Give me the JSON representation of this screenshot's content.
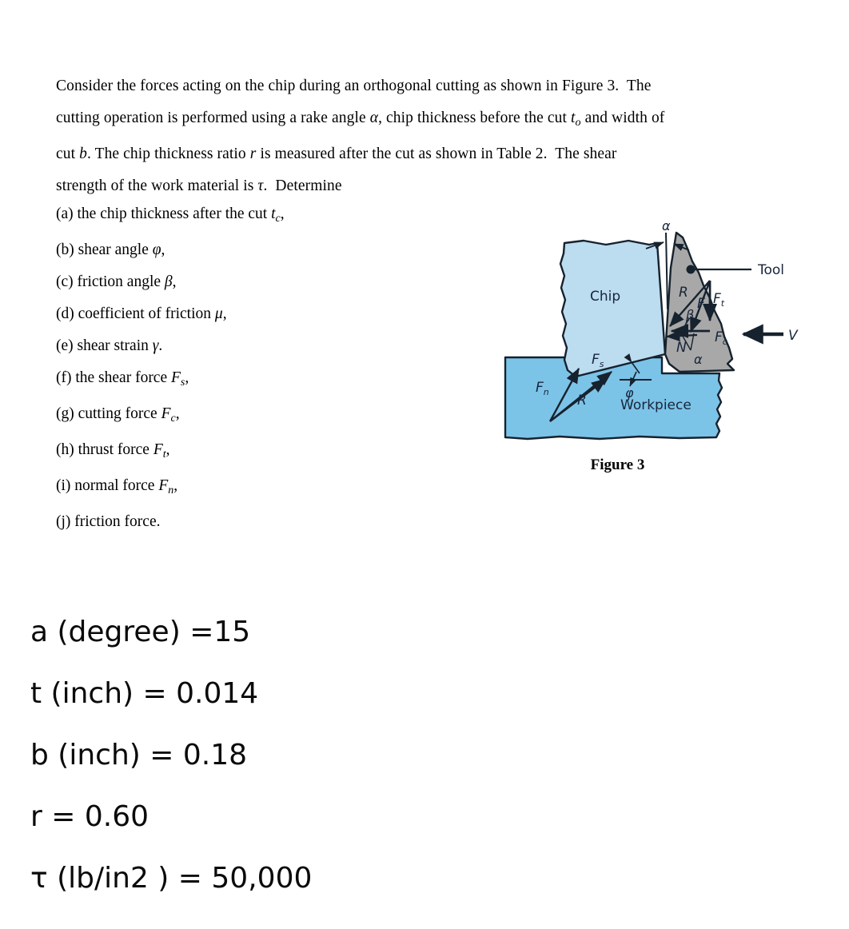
{
  "document": {
    "body_paragraph": "Consider the forces acting on the chip during an orthogonal cutting as shown in Figure 3.  The cutting operation is performed using a rake angle α, chip thickness before the cut t₀ and width of cut b. The chip thickness ratio r is measured after the cut as shown in Table 2.  The shear strength of the work material is τ.  Determine",
    "paragraph_lines": [
      "Consider the forces acting on the chip during an orthogonal cutting as shown in Figure 3.  The",
      "cutting operation is performed using a rake angle α, chip thickness before the cut t₀ and width of",
      "cut b. The chip thickness ratio r is measured after the cut as shown in Table 2.  The shear",
      "strength of the work material is τ.  Determine"
    ],
    "requirements": [
      "(a) the chip thickness after the cut t_c,",
      "(b) shear angle φ,",
      "(c) friction angle β,",
      "(d) coefficient of friction μ,",
      "(e) shear strain γ.",
      "(f) the shear force F_s,",
      "(g) cutting force F_c,",
      "(h) thrust force F_t,",
      "(i) normal force F_n,",
      "(j) friction force."
    ]
  },
  "figure": {
    "caption": "Figure 3",
    "labels": {
      "chip": "Chip",
      "workpiece": "Workpiece",
      "tool": "Tool",
      "velocity": "V",
      "shear_force": "Fs",
      "normal_to_shear_force": "Fn",
      "resultant_shear_plane": "R",
      "shear_angle": "φ",
      "rake_angle_top": "α",
      "rake_angle_force": "α",
      "resultant_tool": "R",
      "friction_force": "F",
      "thrust_force": "Ft",
      "cutting_force": "Fc",
      "normal_force": "N",
      "friction_angle": "β"
    },
    "colors": {
      "chip_fill": "#bcdcf0",
      "workpiece_fill": "#7cc3e8",
      "tool_fill": "#a8a8a8",
      "outline": "#16222e",
      "label_text": "#17263a"
    }
  },
  "parameters": {
    "lines": [
      "a (degree) =15",
      "t (inch) = 0.014",
      "b (inch) = 0.18",
      "r = 0.60",
      "τ (lb/in2 ) = 50,000"
    ],
    "values": {
      "rake_angle_deg": 15,
      "chip_thickness_before_cut_inch": 0.014,
      "width_of_cut_inch": 0.18,
      "chip_thickness_ratio": 0.6,
      "shear_strength_lb_per_in2": 50000
    }
  }
}
